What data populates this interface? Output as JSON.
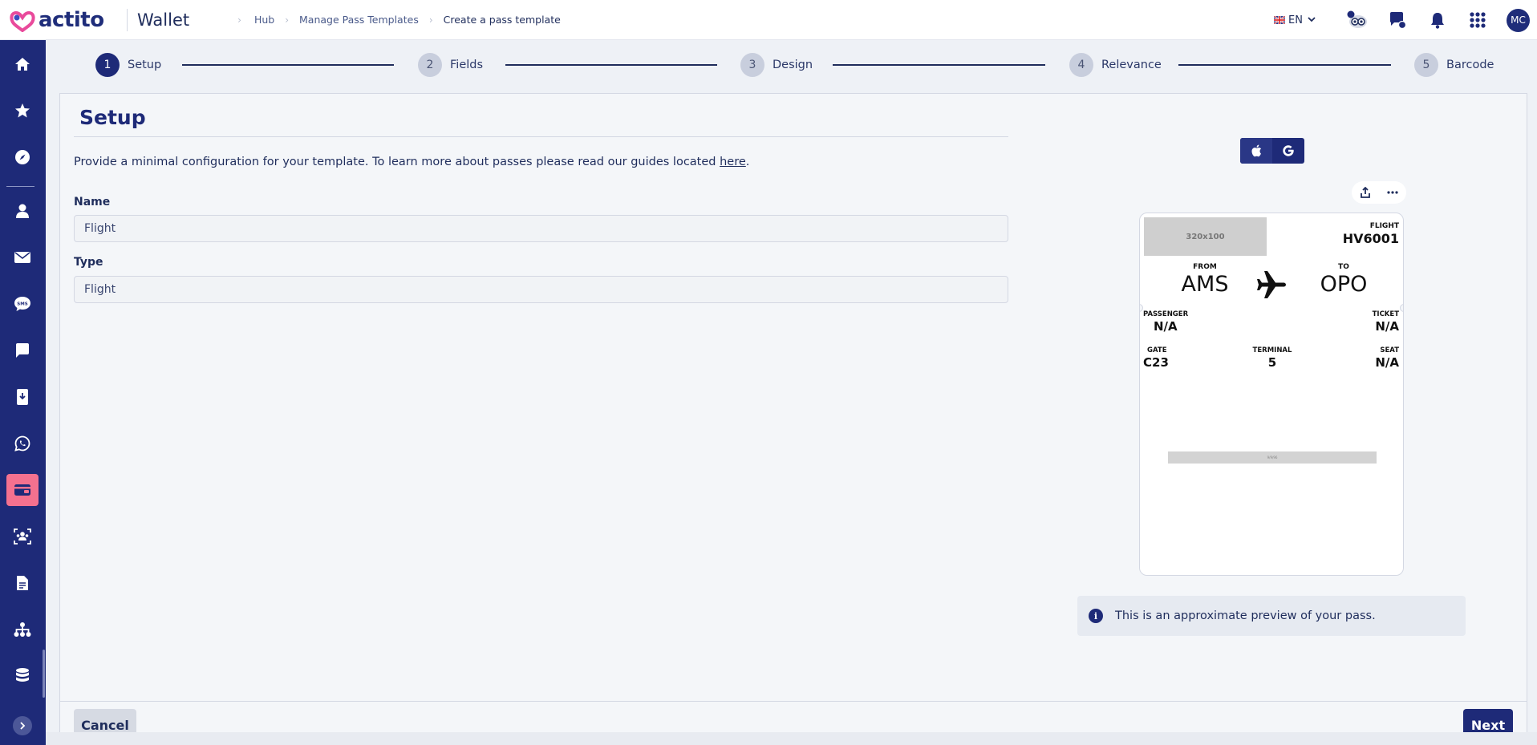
{
  "header": {
    "logo_text": "actito",
    "app_title": "Wallet",
    "breadcrumbs": [
      "Hub",
      "Manage Pass Templates",
      "Create a pass template"
    ],
    "language": "EN",
    "avatar_initials": "MC",
    "icons": [
      "flag-uk-icon",
      "chevron-down-icon",
      "mascot-notification-icon",
      "chat-help-icon",
      "bell-icon",
      "apps-grid-icon"
    ]
  },
  "sidebar": {
    "items": [
      {
        "name": "home-icon"
      },
      {
        "name": "star-icon"
      },
      {
        "name": "compass-icon"
      },
      {
        "name": "contacts-icon"
      },
      {
        "name": "email-icon"
      },
      {
        "name": "sms-icon"
      },
      {
        "name": "chat-icon"
      },
      {
        "name": "mobile-push-icon"
      },
      {
        "name": "whatsapp-icon"
      },
      {
        "name": "wallet-icon",
        "active": true
      },
      {
        "name": "audience-scan-icon"
      },
      {
        "name": "document-icon"
      },
      {
        "name": "sitemap-icon"
      },
      {
        "name": "database-icon"
      }
    ],
    "active_color": "#f4718f",
    "bg_color": "#1e2a78"
  },
  "stepper": {
    "steps": [
      {
        "num": "1",
        "label": "Setup",
        "active": true
      },
      {
        "num": "2",
        "label": "Fields"
      },
      {
        "num": "3",
        "label": "Design"
      },
      {
        "num": "4",
        "label": "Relevance"
      },
      {
        "num": "5",
        "label": "Barcode"
      }
    ]
  },
  "setup": {
    "title": "Setup",
    "intro_text": "Provide a minimal configuration for your template. To learn more about passes please read our guides located ",
    "intro_link": "here",
    "intro_end": ".",
    "name_label": "Name",
    "name_value": "Flight",
    "type_label": "Type",
    "type_value": "Flight"
  },
  "preview": {
    "image_placeholder": "320x100",
    "flight_label": "FLIGHT",
    "flight_value": "HV6001",
    "from_label": "FROM",
    "from_value": "AMS",
    "to_label": "TO",
    "to_value": "OPO",
    "passenger_label": "PASSENGER",
    "passenger_value": "N/A",
    "ticket_label": "TICKET",
    "ticket_value": "N/A",
    "gate_label": "GATE",
    "gate_value": "C23",
    "terminal_label": "TERMINAL",
    "terminal_value": "5",
    "seat_label": "SEAT",
    "seat_value": "N/A",
    "barcode_text": "9/9/96",
    "info_text": "This is an approximate preview of your pass."
  },
  "footer": {
    "cancel_label": "Cancel",
    "next_label": "Next"
  }
}
